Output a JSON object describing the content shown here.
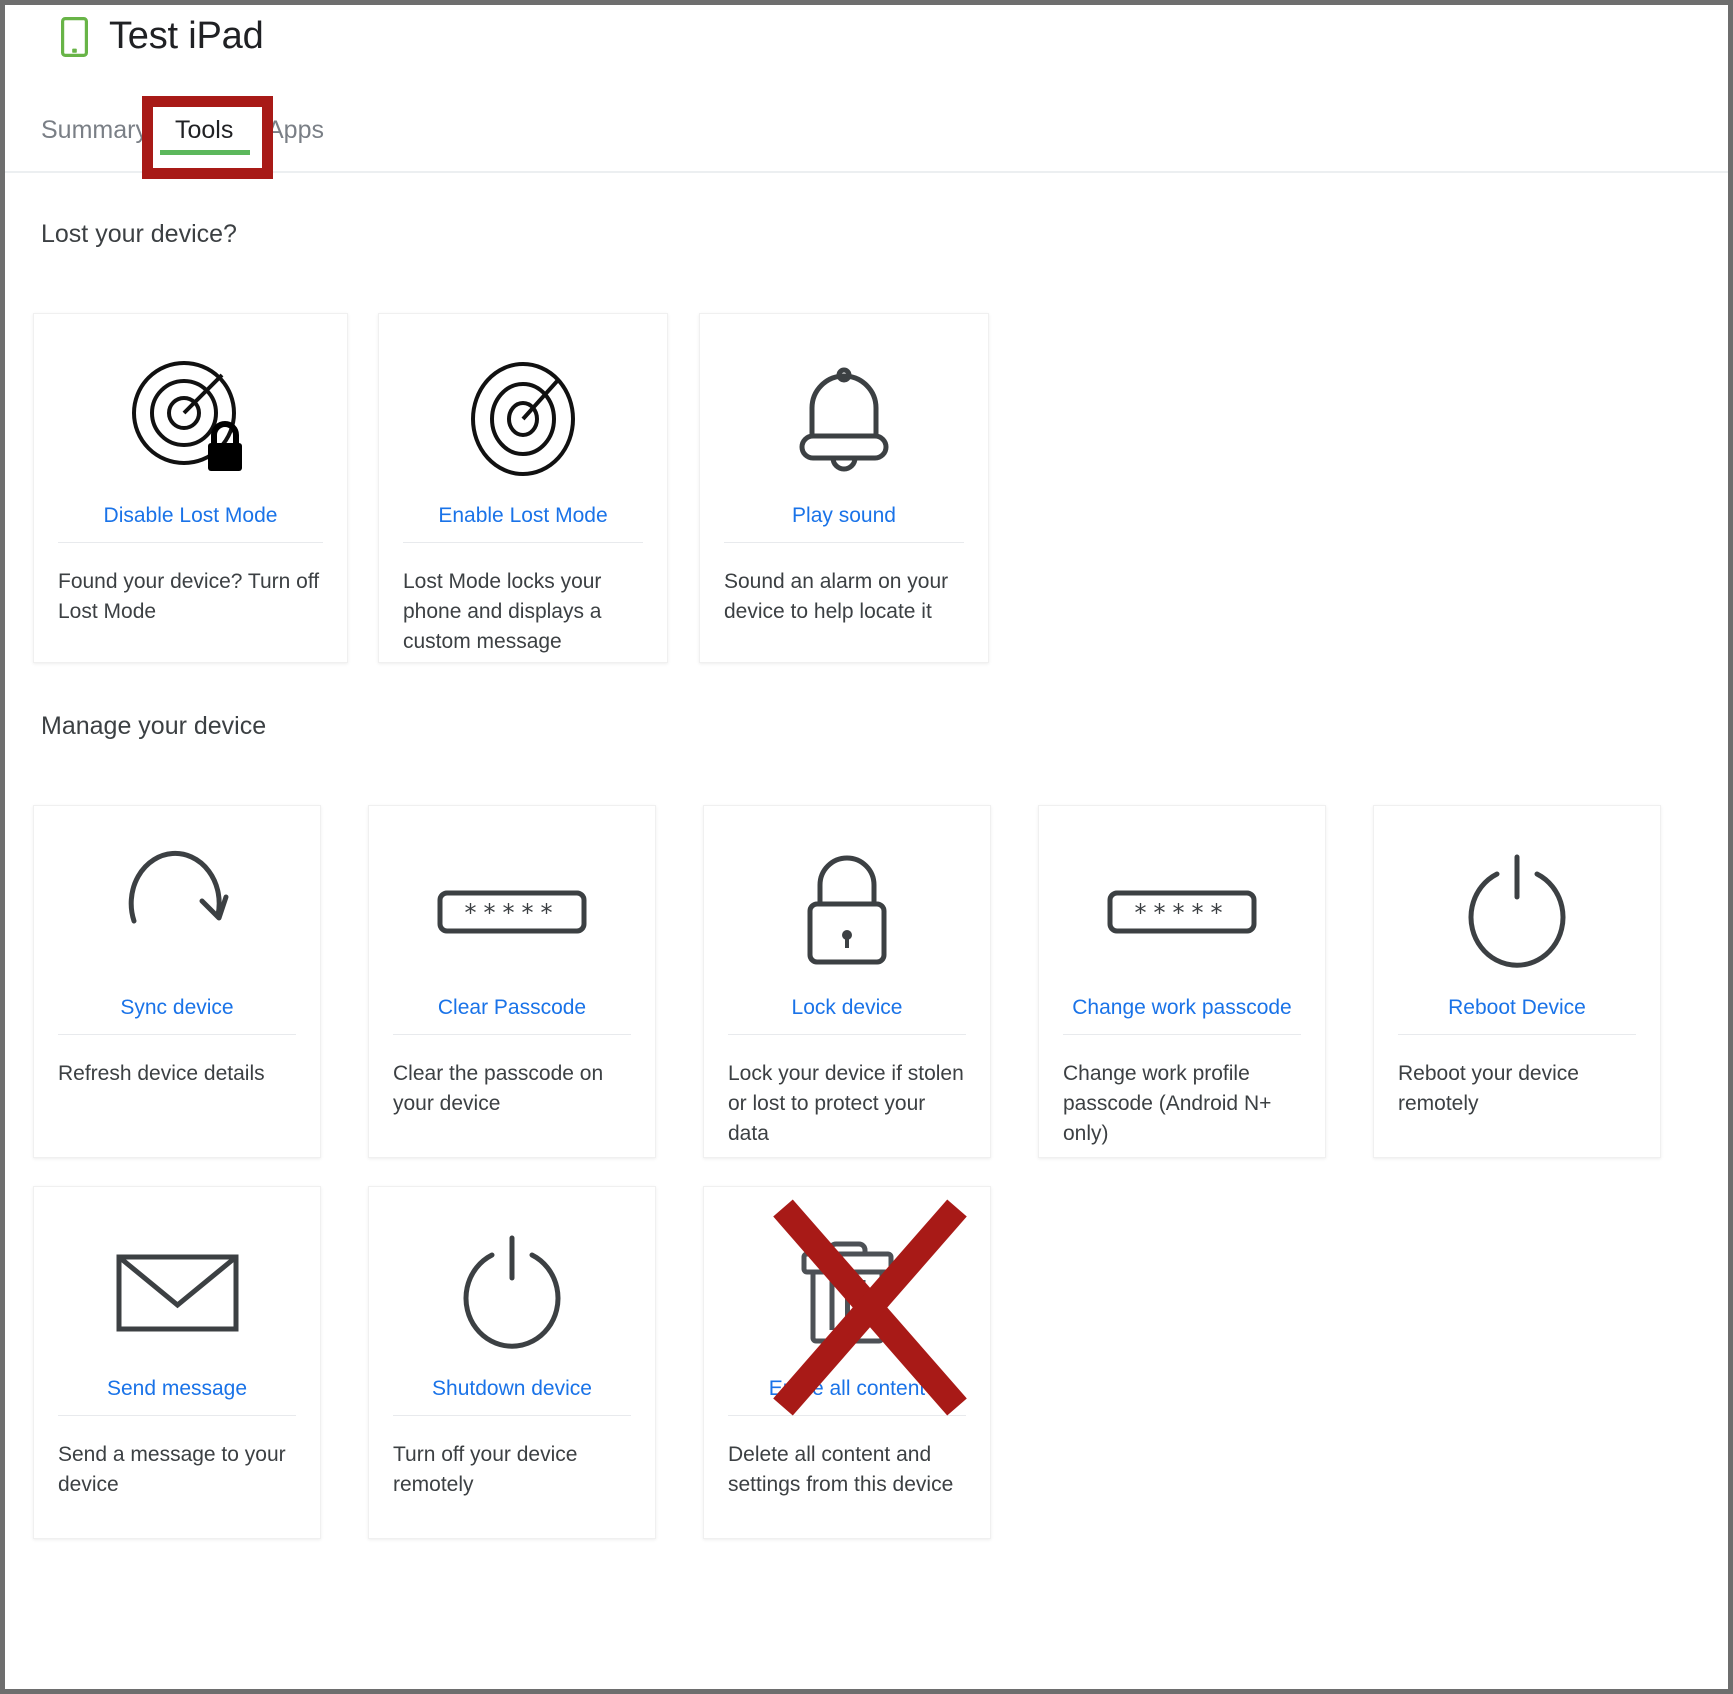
{
  "header": {
    "device_icon": "tablet-icon",
    "device_icon_color": "#68b447",
    "device_title": "Test iPad",
    "tabs": [
      {
        "label": "Summary",
        "active": false
      },
      {
        "label": "Tools",
        "active": true
      },
      {
        "label": "Apps",
        "active": false
      }
    ],
    "active_tab_underline_color": "#5cb85c",
    "annotation_box_color": "#a81a17"
  },
  "link_color": "#1a73e8",
  "sections": [
    {
      "title": "Lost your device?",
      "cards": [
        {
          "icon": "radar-lock-icon",
          "link": "Disable Lost Mode",
          "desc": "Found your device? Turn off Lost Mode"
        },
        {
          "icon": "radar-icon",
          "link": "Enable Lost Mode",
          "desc": "Lost Mode locks your phone and displays a custom message"
        },
        {
          "icon": "bell-icon",
          "link": "Play sound",
          "desc": "Sound an alarm on your device to help locate it"
        }
      ]
    },
    {
      "title": "Manage your device",
      "cards": [
        {
          "icon": "sync-circular-arrow-icon",
          "link": "Sync device",
          "desc": "Refresh device details"
        },
        {
          "icon": "passcode-asterisks-icon",
          "link": "Clear Passcode",
          "desc": "Clear the passcode on your device"
        },
        {
          "icon": "padlock-icon",
          "link": "Lock device",
          "desc": "Lock your device if stolen or lost to protect your data"
        },
        {
          "icon": "passcode-asterisks-icon",
          "link": "Change work passcode",
          "desc": "Change work profile passcode (Android N+ only)"
        },
        {
          "icon": "power-icon",
          "link": "Reboot Device",
          "desc": "Reboot your device remotely"
        },
        {
          "icon": "envelope-icon",
          "link": "Send message",
          "desc": "Send a message to your device"
        },
        {
          "icon": "power-icon",
          "link": "Shutdown device",
          "desc": "Turn off your device remotely"
        },
        {
          "icon": "trash-icon",
          "link": "Erase all content",
          "desc": "Delete all content and settings from this device"
        }
      ]
    }
  ],
  "annotations": {
    "erase_card_cross_out": {
      "shape": "red-x",
      "color": "#a81a17",
      "target": "Erase all content"
    }
  }
}
